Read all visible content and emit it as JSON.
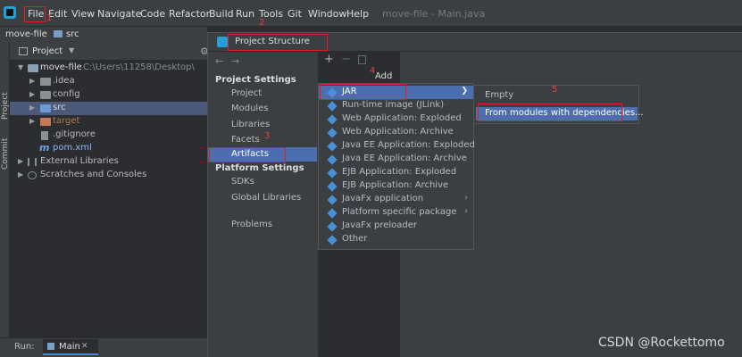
{
  "menubar": {
    "items": [
      "File",
      "Edit",
      "View",
      "Navigate",
      "Code",
      "Refactor",
      "Build",
      "Run",
      "Tools",
      "Git",
      "Window",
      "Help"
    ],
    "window_title": "move-file - Main.java"
  },
  "breadcrumb": {
    "project": "move-file",
    "folder": "src"
  },
  "left_tools": {
    "project_tab": "Project",
    "commit_tab": "Commit"
  },
  "project_panel": {
    "title": "Project",
    "tree": [
      {
        "label": "move-file",
        "path": "C:\\Users\\11258\\Desktop\\",
        "kind": "module"
      },
      {
        "label": ".idea",
        "kind": "folder"
      },
      {
        "label": "config",
        "kind": "folder"
      },
      {
        "label": "src",
        "kind": "folder-source"
      },
      {
        "label": "target",
        "kind": "folder-excluded"
      },
      {
        "label": ".gitignore",
        "kind": "file"
      },
      {
        "label": "pom.xml",
        "kind": "maven"
      },
      {
        "label": "External Libraries",
        "kind": "library"
      },
      {
        "label": "Scratches and Consoles",
        "kind": "scratch"
      }
    ]
  },
  "run_bar": {
    "label": "Run:",
    "tab": "Main"
  },
  "dialog": {
    "title": "Project Structure",
    "sections": [
      {
        "header": "Project Settings",
        "items": [
          "Project",
          "Modules",
          "Libraries",
          "Facets",
          "Artifacts"
        ]
      },
      {
        "header": "Platform Settings",
        "items": [
          "SDKs",
          "Global Libraries"
        ]
      },
      {
        "header": "",
        "items": [
          "Problems"
        ]
      }
    ],
    "selected": "Artifacts"
  },
  "add_popup": {
    "title": "Add",
    "items": [
      {
        "label": "JAR",
        "submenu": true
      },
      {
        "label": "Run-time image (JLink)",
        "submenu": false
      },
      {
        "label": "Web Application: Exploded",
        "submenu": false
      },
      {
        "label": "Web Application: Archive",
        "submenu": false
      },
      {
        "label": "Java EE Application: Exploded",
        "submenu": false
      },
      {
        "label": "Java EE Application: Archive",
        "submenu": false
      },
      {
        "label": "EJB Application: Exploded",
        "submenu": false
      },
      {
        "label": "EJB Application: Archive",
        "submenu": false
      },
      {
        "label": "JavaFx application",
        "submenu": true
      },
      {
        "label": "Platform specific package",
        "submenu": true
      },
      {
        "label": "JavaFx preloader",
        "submenu": false
      },
      {
        "label": "Other",
        "submenu": false
      }
    ]
  },
  "jar_submenu": {
    "items": [
      "Empty",
      "From modules with dependencies..."
    ]
  },
  "annotations": [
    "1",
    "2",
    "3",
    "4",
    "5"
  ],
  "watermark": "CSDN @Rockettomo",
  "colors": {
    "selection": "#4b6eaf",
    "highlight_red": "#e02020",
    "icon_blue": "#4a90d9"
  }
}
